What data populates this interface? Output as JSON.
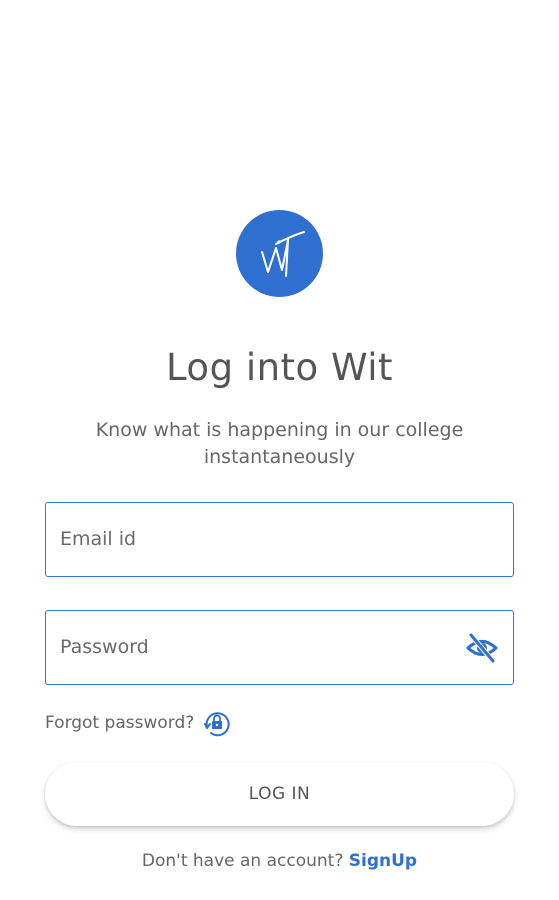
{
  "app": {
    "title": "Log into Wit",
    "subtitle": "Know what is happening in our college instantaneously",
    "logo_icon": "wit-logo-icon"
  },
  "form": {
    "email_placeholder": "Email id",
    "email_value": "",
    "password_placeholder": "Password",
    "password_value": "",
    "password_toggle_icon": "eye-off-icon",
    "forgot_label": "Forgot password?",
    "forgot_icon": "lock-reset-icon",
    "login_label": "LOG IN"
  },
  "footer": {
    "prompt": "Don't have an account?",
    "signup_label": "SignUp"
  },
  "colors": {
    "accent": "#2f6fd0",
    "field_border": "#3a74d4",
    "text": "#555555",
    "background": "#ffffff"
  }
}
